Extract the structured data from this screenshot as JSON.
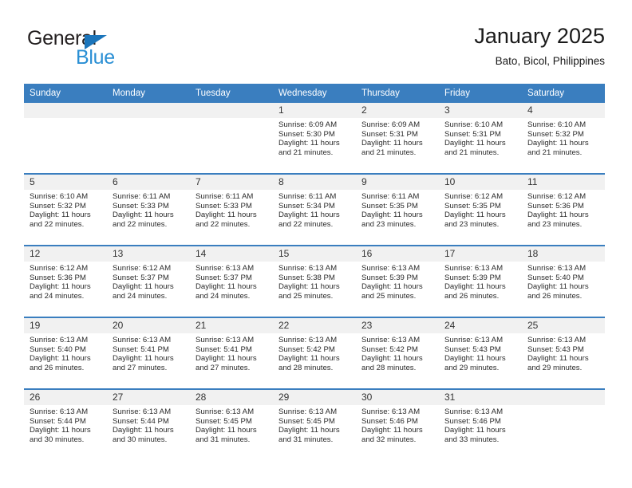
{
  "brand": {
    "name_top": "General",
    "name_bottom": "Blue",
    "accent_color": "#2a8fd4",
    "triangle_color": "#1b75bb"
  },
  "header": {
    "title": "January 2025",
    "location": "Bato, Bicol, Philippines"
  },
  "theme": {
    "header_bg": "#3a7ebf",
    "daynum_bg": "#f1f1f1",
    "text_color": "#2b2b2b"
  },
  "weekdays": [
    "Sunday",
    "Monday",
    "Tuesday",
    "Wednesday",
    "Thursday",
    "Friday",
    "Saturday"
  ],
  "weeks": [
    [
      {
        "day": "",
        "sunrise": "",
        "sunset": "",
        "daylight1": "",
        "daylight2": ""
      },
      {
        "day": "",
        "sunrise": "",
        "sunset": "",
        "daylight1": "",
        "daylight2": ""
      },
      {
        "day": "",
        "sunrise": "",
        "sunset": "",
        "daylight1": "",
        "daylight2": ""
      },
      {
        "day": "1",
        "sunrise": "Sunrise: 6:09 AM",
        "sunset": "Sunset: 5:30 PM",
        "daylight1": "Daylight: 11 hours",
        "daylight2": "and 21 minutes."
      },
      {
        "day": "2",
        "sunrise": "Sunrise: 6:09 AM",
        "sunset": "Sunset: 5:31 PM",
        "daylight1": "Daylight: 11 hours",
        "daylight2": "and 21 minutes."
      },
      {
        "day": "3",
        "sunrise": "Sunrise: 6:10 AM",
        "sunset": "Sunset: 5:31 PM",
        "daylight1": "Daylight: 11 hours",
        "daylight2": "and 21 minutes."
      },
      {
        "day": "4",
        "sunrise": "Sunrise: 6:10 AM",
        "sunset": "Sunset: 5:32 PM",
        "daylight1": "Daylight: 11 hours",
        "daylight2": "and 21 minutes."
      }
    ],
    [
      {
        "day": "5",
        "sunrise": "Sunrise: 6:10 AM",
        "sunset": "Sunset: 5:32 PM",
        "daylight1": "Daylight: 11 hours",
        "daylight2": "and 22 minutes."
      },
      {
        "day": "6",
        "sunrise": "Sunrise: 6:11 AM",
        "sunset": "Sunset: 5:33 PM",
        "daylight1": "Daylight: 11 hours",
        "daylight2": "and 22 minutes."
      },
      {
        "day": "7",
        "sunrise": "Sunrise: 6:11 AM",
        "sunset": "Sunset: 5:33 PM",
        "daylight1": "Daylight: 11 hours",
        "daylight2": "and 22 minutes."
      },
      {
        "day": "8",
        "sunrise": "Sunrise: 6:11 AM",
        "sunset": "Sunset: 5:34 PM",
        "daylight1": "Daylight: 11 hours",
        "daylight2": "and 22 minutes."
      },
      {
        "day": "9",
        "sunrise": "Sunrise: 6:11 AM",
        "sunset": "Sunset: 5:35 PM",
        "daylight1": "Daylight: 11 hours",
        "daylight2": "and 23 minutes."
      },
      {
        "day": "10",
        "sunrise": "Sunrise: 6:12 AM",
        "sunset": "Sunset: 5:35 PM",
        "daylight1": "Daylight: 11 hours",
        "daylight2": "and 23 minutes."
      },
      {
        "day": "11",
        "sunrise": "Sunrise: 6:12 AM",
        "sunset": "Sunset: 5:36 PM",
        "daylight1": "Daylight: 11 hours",
        "daylight2": "and 23 minutes."
      }
    ],
    [
      {
        "day": "12",
        "sunrise": "Sunrise: 6:12 AM",
        "sunset": "Sunset: 5:36 PM",
        "daylight1": "Daylight: 11 hours",
        "daylight2": "and 24 minutes."
      },
      {
        "day": "13",
        "sunrise": "Sunrise: 6:12 AM",
        "sunset": "Sunset: 5:37 PM",
        "daylight1": "Daylight: 11 hours",
        "daylight2": "and 24 minutes."
      },
      {
        "day": "14",
        "sunrise": "Sunrise: 6:13 AM",
        "sunset": "Sunset: 5:37 PM",
        "daylight1": "Daylight: 11 hours",
        "daylight2": "and 24 minutes."
      },
      {
        "day": "15",
        "sunrise": "Sunrise: 6:13 AM",
        "sunset": "Sunset: 5:38 PM",
        "daylight1": "Daylight: 11 hours",
        "daylight2": "and 25 minutes."
      },
      {
        "day": "16",
        "sunrise": "Sunrise: 6:13 AM",
        "sunset": "Sunset: 5:39 PM",
        "daylight1": "Daylight: 11 hours",
        "daylight2": "and 25 minutes."
      },
      {
        "day": "17",
        "sunrise": "Sunrise: 6:13 AM",
        "sunset": "Sunset: 5:39 PM",
        "daylight1": "Daylight: 11 hours",
        "daylight2": "and 26 minutes."
      },
      {
        "day": "18",
        "sunrise": "Sunrise: 6:13 AM",
        "sunset": "Sunset: 5:40 PM",
        "daylight1": "Daylight: 11 hours",
        "daylight2": "and 26 minutes."
      }
    ],
    [
      {
        "day": "19",
        "sunrise": "Sunrise: 6:13 AM",
        "sunset": "Sunset: 5:40 PM",
        "daylight1": "Daylight: 11 hours",
        "daylight2": "and 26 minutes."
      },
      {
        "day": "20",
        "sunrise": "Sunrise: 6:13 AM",
        "sunset": "Sunset: 5:41 PM",
        "daylight1": "Daylight: 11 hours",
        "daylight2": "and 27 minutes."
      },
      {
        "day": "21",
        "sunrise": "Sunrise: 6:13 AM",
        "sunset": "Sunset: 5:41 PM",
        "daylight1": "Daylight: 11 hours",
        "daylight2": "and 27 minutes."
      },
      {
        "day": "22",
        "sunrise": "Sunrise: 6:13 AM",
        "sunset": "Sunset: 5:42 PM",
        "daylight1": "Daylight: 11 hours",
        "daylight2": "and 28 minutes."
      },
      {
        "day": "23",
        "sunrise": "Sunrise: 6:13 AM",
        "sunset": "Sunset: 5:42 PM",
        "daylight1": "Daylight: 11 hours",
        "daylight2": "and 28 minutes."
      },
      {
        "day": "24",
        "sunrise": "Sunrise: 6:13 AM",
        "sunset": "Sunset: 5:43 PM",
        "daylight1": "Daylight: 11 hours",
        "daylight2": "and 29 minutes."
      },
      {
        "day": "25",
        "sunrise": "Sunrise: 6:13 AM",
        "sunset": "Sunset: 5:43 PM",
        "daylight1": "Daylight: 11 hours",
        "daylight2": "and 29 minutes."
      }
    ],
    [
      {
        "day": "26",
        "sunrise": "Sunrise: 6:13 AM",
        "sunset": "Sunset: 5:44 PM",
        "daylight1": "Daylight: 11 hours",
        "daylight2": "and 30 minutes."
      },
      {
        "day": "27",
        "sunrise": "Sunrise: 6:13 AM",
        "sunset": "Sunset: 5:44 PM",
        "daylight1": "Daylight: 11 hours",
        "daylight2": "and 30 minutes."
      },
      {
        "day": "28",
        "sunrise": "Sunrise: 6:13 AM",
        "sunset": "Sunset: 5:45 PM",
        "daylight1": "Daylight: 11 hours",
        "daylight2": "and 31 minutes."
      },
      {
        "day": "29",
        "sunrise": "Sunrise: 6:13 AM",
        "sunset": "Sunset: 5:45 PM",
        "daylight1": "Daylight: 11 hours",
        "daylight2": "and 31 minutes."
      },
      {
        "day": "30",
        "sunrise": "Sunrise: 6:13 AM",
        "sunset": "Sunset: 5:46 PM",
        "daylight1": "Daylight: 11 hours",
        "daylight2": "and 32 minutes."
      },
      {
        "day": "31",
        "sunrise": "Sunrise: 6:13 AM",
        "sunset": "Sunset: 5:46 PM",
        "daylight1": "Daylight: 11 hours",
        "daylight2": "and 33 minutes."
      },
      {
        "day": "",
        "sunrise": "",
        "sunset": "",
        "daylight1": "",
        "daylight2": ""
      }
    ]
  ]
}
